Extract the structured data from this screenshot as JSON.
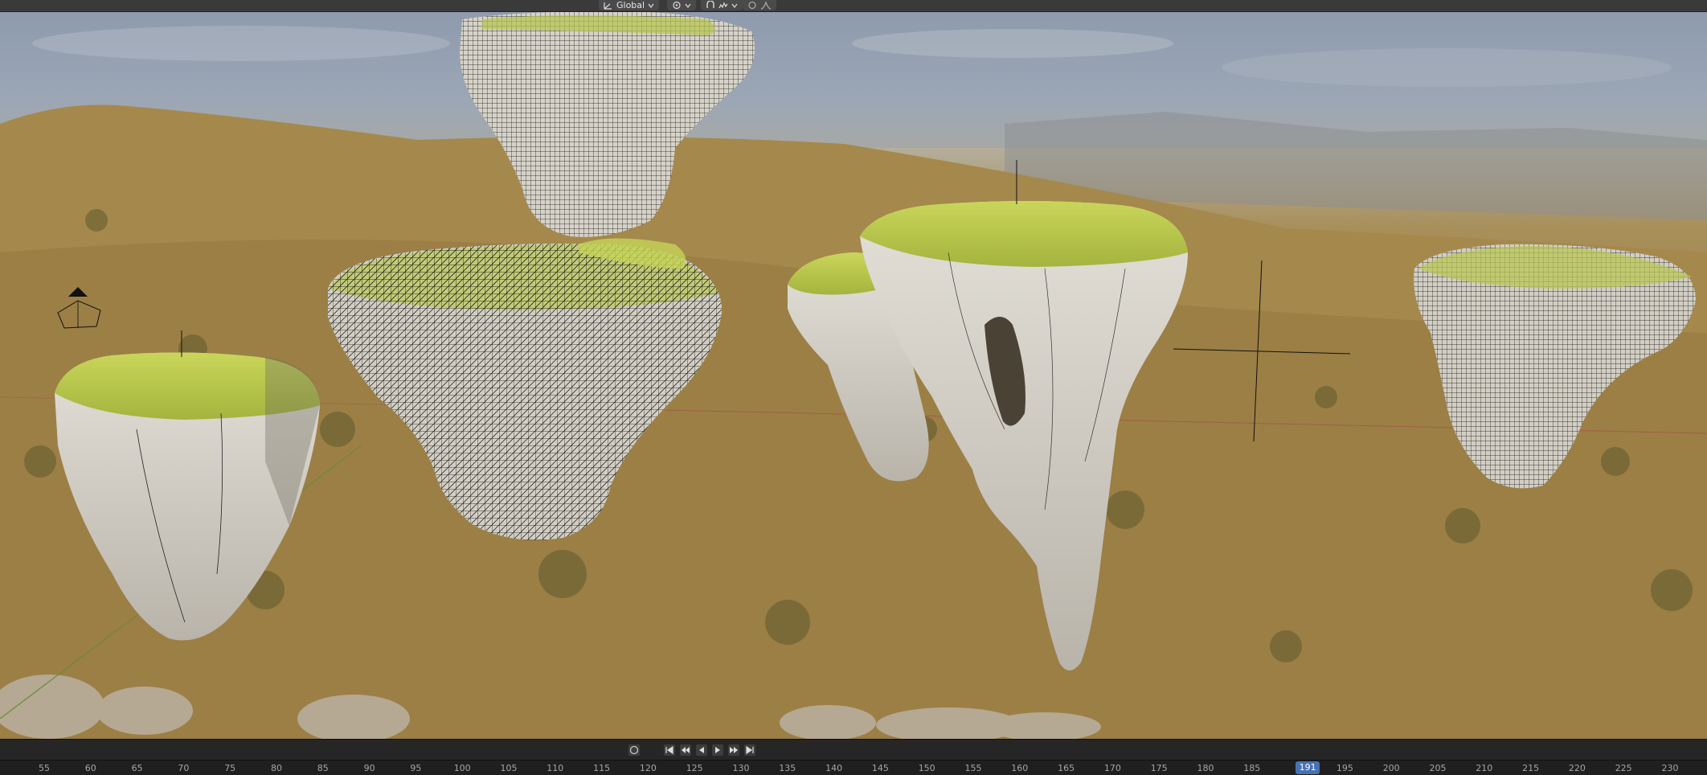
{
  "header": {
    "transform_orientation": "Global",
    "icons": [
      "orientation-icon",
      "pivot-icon",
      "snap-icon",
      "proportional-icon",
      "gizmo-icon"
    ]
  },
  "viewport": {
    "objects": [
      "floating-rock-1",
      "floating-rock-2",
      "floating-rock-3",
      "floating-rock-4",
      "floating-rock-5",
      "floating-rock-6"
    ],
    "icons": [
      "camera-icon",
      "empty-cross-icon"
    ]
  },
  "timeline": {
    "current_frame": "191",
    "ticks": [
      "55",
      "60",
      "65",
      "70",
      "75",
      "80",
      "85",
      "90",
      "95",
      "100",
      "105",
      "110",
      "115",
      "120",
      "125",
      "130",
      "135",
      "140",
      "145",
      "150",
      "155",
      "160",
      "165",
      "170",
      "175",
      "180",
      "185",
      "195",
      "200",
      "205",
      "210",
      "215",
      "220",
      "225",
      "230"
    ],
    "controls": [
      "record-icon",
      "jump-start-icon",
      "prev-keyframe-icon",
      "play-reverse-icon",
      "play-icon",
      "next-keyframe-icon",
      "jump-end-icon"
    ]
  },
  "colors": {
    "playhead": "#4772b3",
    "moss": "#b8c94a",
    "rock": "#d8d4cc"
  }
}
